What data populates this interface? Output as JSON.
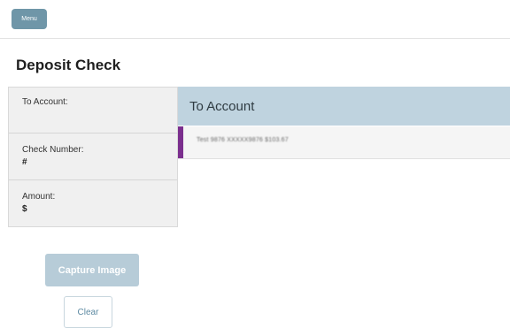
{
  "header": {
    "menu_label": "Menu"
  },
  "page": {
    "title": "Deposit Check"
  },
  "form": {
    "fields": [
      {
        "label": "To Account:",
        "value": ""
      },
      {
        "label": "Check Number:",
        "value": "#"
      },
      {
        "label": "Amount:",
        "value": "$"
      }
    ]
  },
  "account_picker": {
    "header": "To Account",
    "options": [
      {
        "label": "Test 9876 XXXXX9876 $103.67"
      }
    ]
  },
  "actions": {
    "capture_label": "Capture Image",
    "clear_label": "Clear"
  },
  "colors": {
    "accent": "#7b2f8e",
    "primary": "#6f96a8",
    "header_bg": "#bfd3df"
  }
}
